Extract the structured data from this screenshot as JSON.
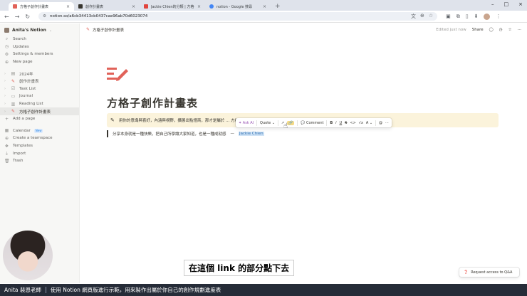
{
  "browser": {
    "tabs": [
      {
        "title": "方格子創作計畫表",
        "favicon_color": "#e16259",
        "active": true
      },
      {
        "title": "創作計畫表",
        "favicon_color": "#37352f",
        "active": false
      },
      {
        "title": "Jackie Chien的分類 | 方格子 v...",
        "favicon_color": "#e1453d",
        "active": false
      },
      {
        "title": "notion - Google 搜尋",
        "favicon_color": "#4285f4",
        "active": false
      }
    ],
    "url": "notion.so/a6cb34413cb0437cae96ab70d6023074"
  },
  "sidebar": {
    "workspace": "Anita's Notion",
    "top_items": [
      {
        "icon": "search-icon",
        "label": "Search"
      },
      {
        "icon": "clock-icon",
        "label": "Updates"
      },
      {
        "icon": "gear-icon",
        "label": "Settings & members"
      },
      {
        "icon": "plus-circle-icon",
        "label": "New page"
      }
    ],
    "pages": [
      {
        "label": "2024年",
        "active": false
      },
      {
        "label": "創作計畫表",
        "active": false
      },
      {
        "label": "Task List",
        "active": false
      },
      {
        "label": "Journal",
        "active": false
      },
      {
        "label": "Reading List",
        "active": false
      },
      {
        "label": "方格子創作計畫表",
        "active": true
      }
    ],
    "add_page": "Add a page",
    "bottom_items": [
      {
        "icon": "calendar-icon",
        "label": "Calendar",
        "badge": "New"
      },
      {
        "icon": "teamspace-icon",
        "label": "Create a teamspace"
      },
      {
        "icon": "template-icon",
        "label": "Templates"
      },
      {
        "icon": "import-icon",
        "label": "Import"
      },
      {
        "icon": "trash-icon",
        "label": "Trash"
      }
    ]
  },
  "topbar": {
    "breadcrumb": "方格子創作計畫表",
    "edited": "Edited just now",
    "share": "Share"
  },
  "page": {
    "title": "方格子創作計畫表",
    "callout": "用你的意識與喜好，內涵與視野，擴展出點燈商，那才是屬於 ... 方格子 ...",
    "quote": "分享本身就是一種快樂，把自己所學讓大家知道，也是一種成就感",
    "quote_dash": "—",
    "quote_author": "Jackie Chien"
  },
  "format_toolbar": {
    "ask_ai": "Ask AI",
    "quote": "Quote",
    "comment": "Comment",
    "bold": "B",
    "italic": "i",
    "underline": "U",
    "strike": "S",
    "code": "<>",
    "sigma": "√x",
    "color": "A"
  },
  "overlay": {
    "subtitle": "在這個 link 的部分點下去",
    "request_access": "Request access to Q&A",
    "banner_name": "Anita 裴恩老師",
    "banner_text": "使用 Notion 網頁版進行示範，用來製作出屬於你自己的創作規劃進度表"
  },
  "colors": {
    "accent": "#e16259",
    "callout_bg": "#fbf3db",
    "highlight": "#cfe3f6",
    "banner_bg": "#262c38"
  }
}
